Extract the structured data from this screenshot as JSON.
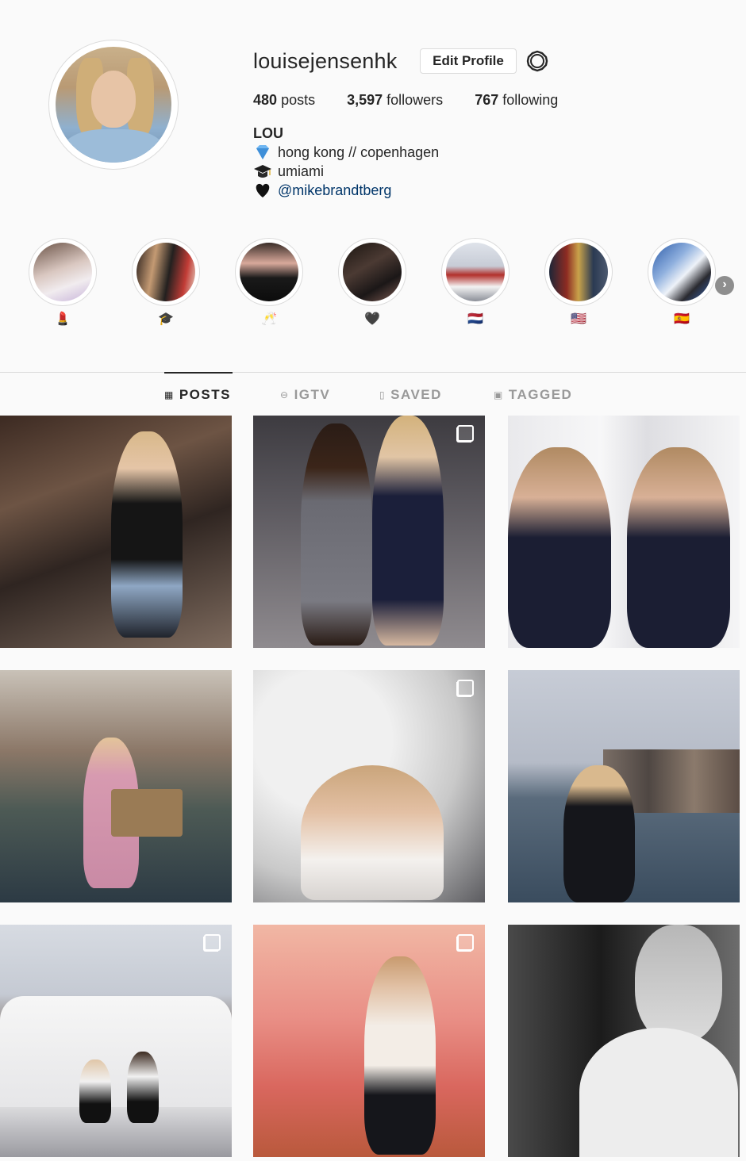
{
  "profile": {
    "username": "louisejensenhk",
    "edit_label": "Edit Profile",
    "stats": {
      "posts_count": "480",
      "posts_label": "posts",
      "followers_count": "3,597",
      "followers_label": "followers",
      "following_count": "767",
      "following_label": "following"
    },
    "bio": {
      "name": "LOU",
      "line1_emoji": "gem-icon",
      "line1": "hong kong // copenhagen",
      "line2_emoji": "graduation-cap-icon",
      "line2": "umiami",
      "line3_emoji": "black-heart-icon",
      "line3": "@mikebrandtberg"
    }
  },
  "highlights": [
    {
      "emoji": "lipstick-icon",
      "glyph": "💄"
    },
    {
      "emoji": "graduation-cap-icon",
      "glyph": "🎓"
    },
    {
      "emoji": "champagne-icon",
      "glyph": "🥂"
    },
    {
      "emoji": "black-heart-icon",
      "glyph": "🖤"
    },
    {
      "emoji": "flag-netherlands-icon",
      "glyph": "🇳🇱"
    },
    {
      "emoji": "flag-usa-icon",
      "glyph": "🇺🇸"
    },
    {
      "emoji": "flag-spain-icon",
      "glyph": "🇪🇸"
    }
  ],
  "tabs": [
    {
      "label": "POSTS",
      "icon": "grid-icon"
    },
    {
      "label": "IGTV",
      "icon": "igtv-icon"
    },
    {
      "label": "SAVED",
      "icon": "bookmark-icon"
    },
    {
      "label": "TAGGED",
      "icon": "tagged-icon"
    }
  ],
  "colors": {
    "accent_link": "#003569",
    "border": "#dbdbdb",
    "background": "#fafafa"
  }
}
